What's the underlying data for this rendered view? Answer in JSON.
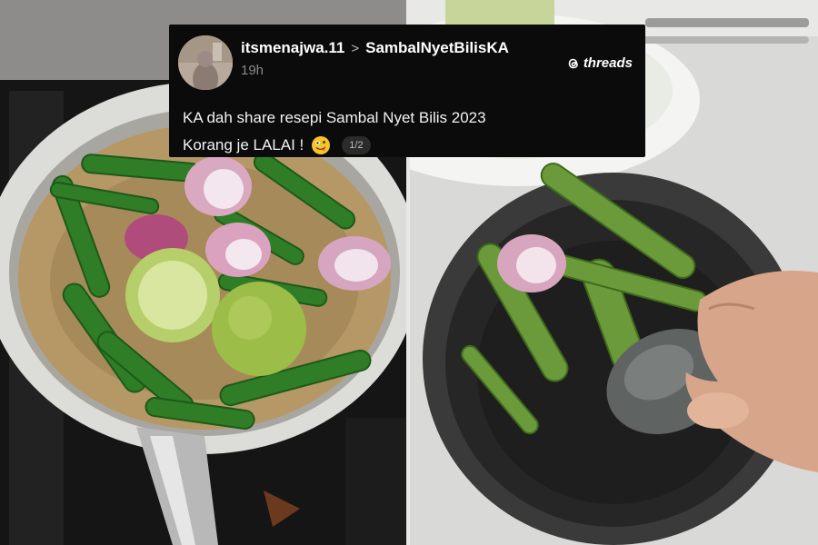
{
  "post": {
    "username": "itsmenajwa.11",
    "separator": ">",
    "topic": "SambalNyetBilisKA",
    "time": "19h",
    "brand": "threads",
    "text_line1": "KA dah share resepi Sambal Nyet Bilis 2023",
    "text_line2": "Korang je LALAI !",
    "emoji": "zany-face-icon",
    "page_indicator": "1/2"
  },
  "photos": {
    "left": "frying-pan-chillies-shallots-tomatoes",
    "right": "stone-mortar-pestle-chillies"
  }
}
